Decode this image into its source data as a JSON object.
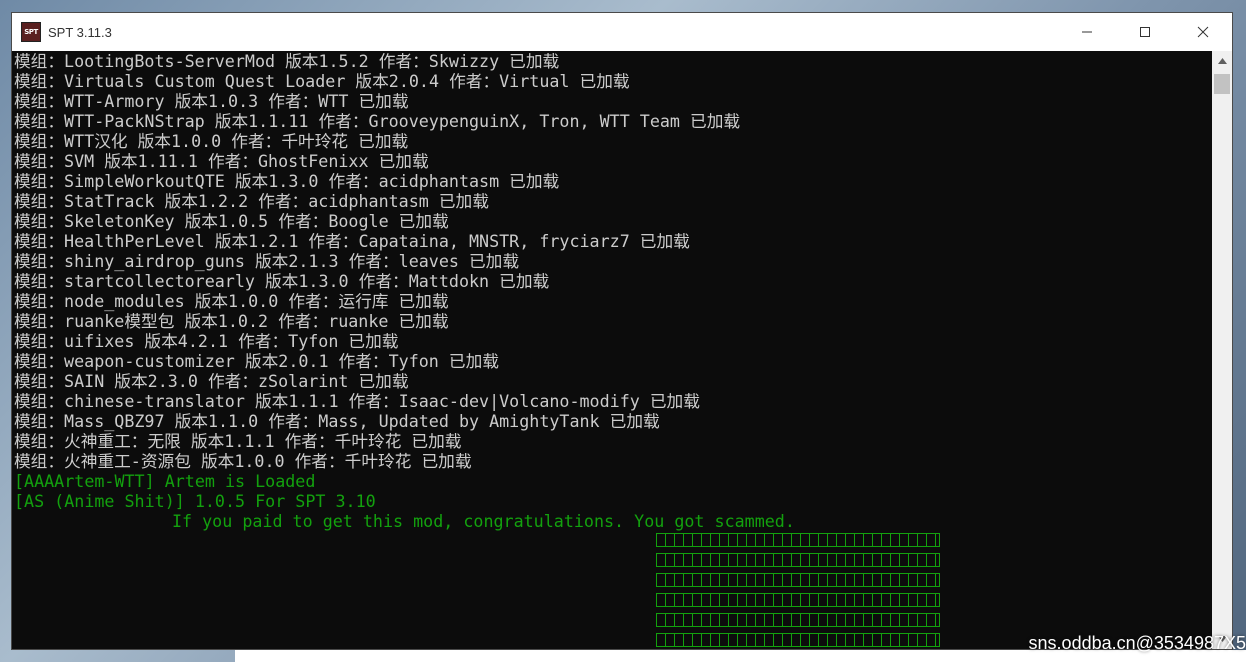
{
  "window": {
    "title": "SPT 3.11.3",
    "icon_text": "SPT",
    "controls": [
      {
        "name": "minimize-button",
        "icon": "minimize-icon"
      },
      {
        "name": "maximize-button",
        "icon": "maximize-icon"
      },
      {
        "name": "close-button",
        "icon": "close-icon"
      }
    ]
  },
  "console": {
    "lines": [
      "模组：LootingBots-ServerMod 版本1.5.2 作者：Skwizzy 已加载",
      "模组：Virtuals Custom Quest Loader 版本2.0.4 作者：Virtual 已加载",
      "模组：WTT-Armory 版本1.0.3 作者：WTT 已加载",
      "模组：WTT-PackNStrap 版本1.1.11 作者：GrooveypenguinX, Tron, WTT Team 已加载",
      "模组：WTT汉化 版本1.0.0 作者：千叶玲花 已加载",
      "模组：SVM 版本1.11.1 作者：GhostFenixx 已加载",
      "模组：SimpleWorkoutQTE 版本1.3.0 作者：acidphantasm 已加载",
      "模组：StatTrack 版本1.2.2 作者：acidphantasm 已加载",
      "模组：SkeletonKey 版本1.0.5 作者：Boogle 已加载",
      "模组：HealthPerLevel 版本1.2.1 作者：Capataina, MNSTR, fryciarz7 已加载",
      "模组：shiny_airdrop_guns 版本2.1.3 作者：leaves 已加载",
      "模组：startcollectorearly 版本1.3.0 作者：Mattdokn 已加载",
      "模组：node_modules 版本1.0.0 作者：运行库 已加载",
      "模组：ruanke模型包 版本1.0.2 作者：ruanke 已加载",
      "模组：uifixes 版本4.2.1 作者：Tyfon 已加载",
      "模组：weapon-customizer 版本2.0.1 作者：Tyfon 已加载",
      "模组：SAIN 版本2.3.0 作者：zSolarint 已加载",
      "模组：chinese-translator 版本1.1.1 作者：Isaac-dev|Volcano-modify 已加载",
      "模组：Mass_QBZ97 版本1.1.0 作者：Mass, Updated by AmightyTank 已加载",
      "模组：火神重工：无限 版本1.1.1 作者：千叶玲花 已加载",
      "模组：火神重工-资源包 版本1.0.0 作者：千叶玲花 已加载"
    ],
    "green_lines": [
      "[AAAArtem-WTT] Artem is Loaded",
      "[AS (Anime Shit)] 1.0.5 For SPT 3.10"
    ],
    "message": "If you paid to get this mod, congratulations. You got scammed.",
    "box_rows": 6,
    "colors": {
      "text": "#cccccc",
      "green": "#13a10e",
      "background": "#0c0c0c"
    }
  },
  "watermark": "sns.oddba.cn@3534987X5"
}
